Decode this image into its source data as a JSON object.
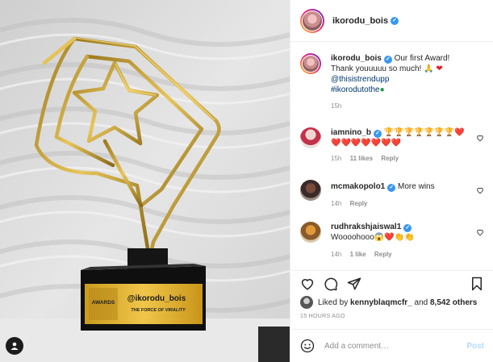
{
  "post": {
    "author": "ikorodu_bois",
    "caption": {
      "text": "Our first Award! Thank youuuuu so much!",
      "mention": "@thisistrendupp",
      "hashtag": "#ikorodutothe",
      "time": "15h"
    },
    "plaque": {
      "handle": "@ikorodu_bois",
      "subtitle": "THE FORCE OF VIRALITY",
      "logo_text": "AWARDS"
    }
  },
  "comments": [
    {
      "user": "iamnino_b",
      "verified": true,
      "text": "🏆🏆🏆🏆🏆🏆🏆❤️❤️❤️❤️❤️❤️❤️❤️",
      "time": "15h",
      "likes": "11 likes",
      "reply": "Reply"
    },
    {
      "user": "mcmakopolo1",
      "verified": true,
      "text": "More wins",
      "time": "14h",
      "reply": "Reply"
    },
    {
      "user": "rudhrakshjaiswal1",
      "verified": true,
      "text": "Woooohooo😱❤️👏👏",
      "time": "14h",
      "likes": "1 like",
      "reply": "Reply"
    }
  ],
  "likes": {
    "prefix": "Liked by",
    "user": "kennyblaqmcfr_",
    "conj": "and",
    "others": "8,542 others"
  },
  "timestamp": "15 HOURS AGO",
  "add_comment": {
    "placeholder": "Add a comment…",
    "post_label": "Post"
  },
  "icons": {
    "header_verified": "verified-icon",
    "like": "heart-icon",
    "comment": "comment-icon",
    "share": "share-icon",
    "save": "bookmark-icon",
    "emoji": "smile-icon",
    "tag": "user-tag-icon"
  },
  "colors": {
    "verified": "#3897f0",
    "link": "#00376b",
    "post_button": "#b3dbff",
    "muted": "#8e8e8e"
  }
}
